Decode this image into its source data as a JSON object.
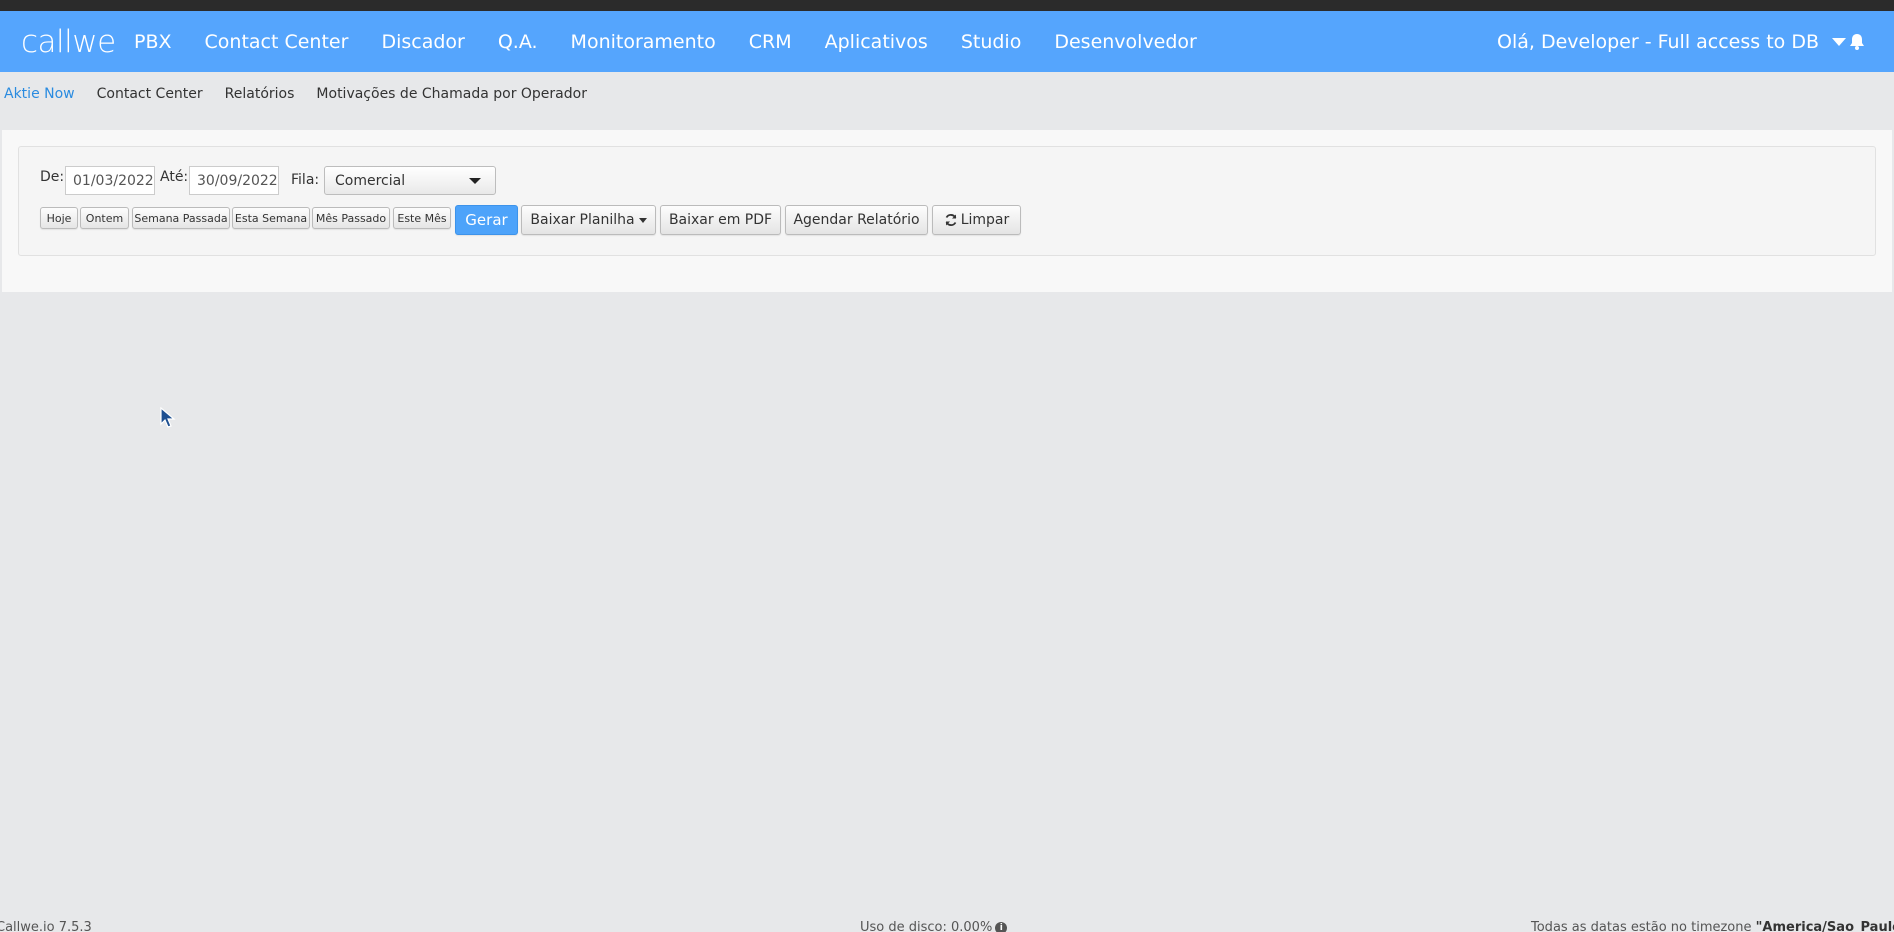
{
  "navbar": {
    "logo": "callwe",
    "items": [
      "PBX",
      "Contact Center",
      "Discador",
      "Q.A.",
      "Monitoramento",
      "CRM",
      "Aplicativos",
      "Studio",
      "Desenvolvedor"
    ],
    "user_greeting": "Olá, Developer - Full access to DB",
    "accent_color": "#55a5fd"
  },
  "breadcrumb": {
    "items": [
      "Aktie Now",
      "Contact Center",
      "Relatórios",
      "Motivações de Chamada por Operador"
    ]
  },
  "filters": {
    "from_label": "De:",
    "from_value": "01/03/2022",
    "to_label": "Até:",
    "to_value": "30/09/2022",
    "queue_label": "Fila:",
    "queue_value": "Comercial"
  },
  "quick_ranges": [
    "Hoje",
    "Ontem",
    "Semana Passada",
    "Esta Semana",
    "Mês Passado",
    "Este Mês"
  ],
  "actions": {
    "generate": "Gerar",
    "download_sheet": "Baixar Planilha",
    "download_pdf": "Baixar em PDF",
    "schedule": "Agendar Relatório",
    "clear": "Limpar"
  },
  "footer": {
    "version": "Callwe.io 7.5.3",
    "disk_usage": "Uso de disco: 0.00%",
    "timezone_prefix": "Todas as datas estão no timezone ",
    "timezone_value": "\"America/Sao_Paulo\""
  }
}
